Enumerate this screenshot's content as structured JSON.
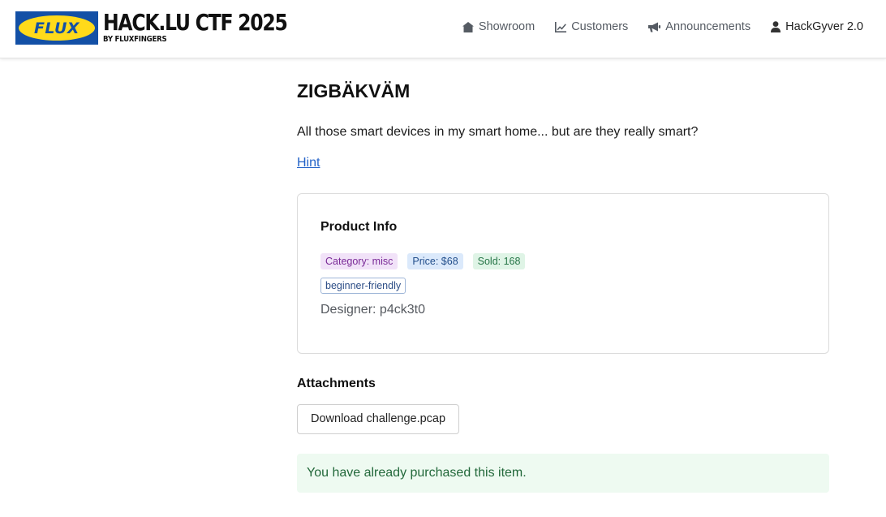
{
  "brand": {
    "logo_text": "FLUX",
    "title": "HACK.LU CTF 2025",
    "subtitle": "BY FLUXFINGERS",
    "colors": {
      "logo_blue": "#1350a6",
      "logo_yellow": "#ffda1a"
    }
  },
  "nav": {
    "items": [
      {
        "label": "Showroom",
        "icon": "home-icon"
      },
      {
        "label": "Customers",
        "icon": "chart-line-icon"
      },
      {
        "label": "Announcements",
        "icon": "megaphone-icon"
      },
      {
        "label": "HackGyver 2.0",
        "icon": "user-icon"
      }
    ]
  },
  "challenge": {
    "title": "ZIGBÄKVÄM",
    "description": "All those smart devices in my smart home... but are they really smart?",
    "hint_label": "Hint"
  },
  "product_info": {
    "heading": "Product Info",
    "badges": {
      "category": "Category: misc",
      "price": "Price: $68",
      "sold": "Sold: 168"
    },
    "tags": [
      "beginner-friendly"
    ],
    "designer": "Designer: p4ck3t0"
  },
  "attachments": {
    "heading": "Attachments",
    "download_label": "Download challenge.pcap"
  },
  "alert": {
    "message": "You have already purchased this item."
  }
}
